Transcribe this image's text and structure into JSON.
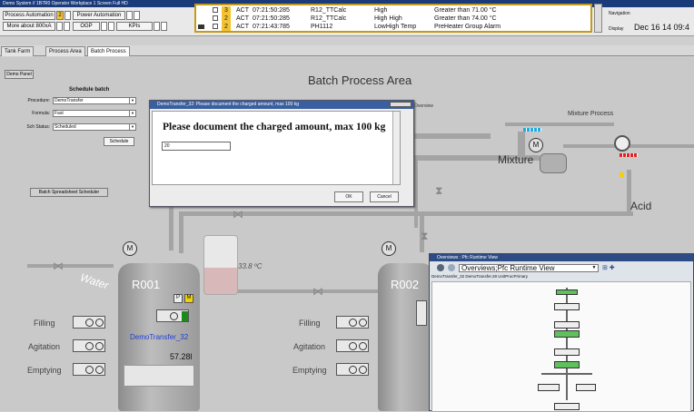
{
  "window": {
    "title": "Demo System // 1B7R0 Operator Workplace 1 Screen Full HD"
  },
  "appbar": {
    "process_automation": "Process Automation",
    "more_about": "More about 800xA",
    "badge_count": "2",
    "power_automation": "Power Automation",
    "ogp": "OGP",
    "kpis": "KPIs"
  },
  "alarms": [
    {
      "priority": "3",
      "status": "ACT",
      "time": "07:21:50:285",
      "object": "R12_TTCalc",
      "condition": "High",
      "message": "Greater than 71.00 °C"
    },
    {
      "priority": "2",
      "status": "ACT",
      "time": "07:21:50:285",
      "object": "R12_TTCalc",
      "condition": "High High",
      "message": "Greater than 74.00 °C"
    },
    {
      "priority": "2",
      "status": "ACT",
      "time": "07:21:43:785",
      "object": "PH1112",
      "condition": "LowHigh Temp",
      "message": "PreHeater Group Alarm"
    }
  ],
  "navigation": {
    "label": "Navigation",
    "display": "Display",
    "datetime": "Dec 16 14 09:4"
  },
  "tabs": [
    {
      "label": "Tank Farm"
    },
    {
      "label": "Process Area"
    },
    {
      "label": "Batch Process"
    }
  ],
  "main": {
    "demo_panel": "Demo Panel",
    "title": "Batch Process Area",
    "mixture_process": "Mixture Process",
    "mixture": "Mixture",
    "acid": "Acid",
    "water": "Water",
    "temperature": "33.8 ºC",
    "overview_link": "Overview",
    "batch_spreadsheet": "Batch Spreadsheet Scheduler"
  },
  "schedule": {
    "heading": "Schedule batch",
    "procedure_label": "Procedure:",
    "procedure_value": "DemoTransfer",
    "formula_label": "Formula:",
    "formula_value": "Fast",
    "status_label": "Sch Status:",
    "status_value": "Scheduled",
    "button": "Schedule"
  },
  "r001": {
    "name": "R001",
    "filling": "Filling",
    "agitation": "Agitation",
    "emptying": "Emptying",
    "batch": "DemoTransfer_32",
    "level": "57.28l",
    "tag_p": "P",
    "tag_m": "M"
  },
  "r002": {
    "name": "R002",
    "filling": "Filling",
    "agitation": "Agitation",
    "emptying": "Emptying"
  },
  "motor_symbol": "M",
  "dialog": {
    "title": "DemoTransfer_32: Please document the charged amount, max 100 kg",
    "prompt": "Please document the charged amount, max 100 kg",
    "input_value": "20",
    "ok": "OK",
    "cancel": "Cancel"
  },
  "runtime": {
    "title": "Overviews : Pfc Runtime View",
    "address": "Overviews;Pfc Runtime View",
    "breadcrumb": "DemoTransfer_32  DemoTransfer.28  UnitProcPrimary"
  },
  "colors": {
    "alarm_border": "#c49a1a",
    "priority": "#f2c233",
    "batch_link": "#1f3fd6",
    "step_active": "#5ec15e"
  }
}
